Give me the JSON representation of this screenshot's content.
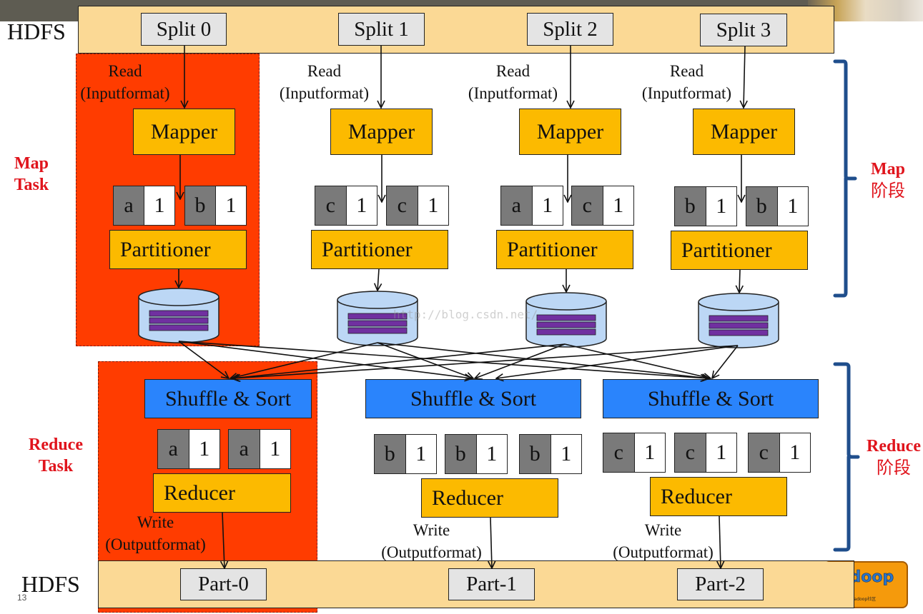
{
  "colors": {
    "hdfs_band": "#fbd995",
    "task_highlight": "#ff3c00",
    "split_box": "#e4e4e4",
    "mapper_box": "#fcba00",
    "shuffle_box": "#2a84fc",
    "key_cell": "#7a7a7a",
    "value_cell": "#ffffff",
    "disk": "#bcd7f5",
    "disk_bars": "#7030a0",
    "bracket": "#1f4e8c",
    "phase_label": "#e0141c"
  },
  "hdfs_top": {
    "label": "HDFS",
    "splits": [
      "Split 0",
      "Split 1",
      "Split 2",
      "Split 3"
    ]
  },
  "map_columns": [
    {
      "read_line1": "Read",
      "read_line2": "(Inputformat)",
      "mapper": "Mapper",
      "pairs": [
        {
          "k": "a",
          "v": "1"
        },
        {
          "k": "b",
          "v": "1"
        }
      ],
      "partitioner": "Partitioner"
    },
    {
      "read_line1": "Read",
      "read_line2": "(Inputformat)",
      "mapper": "Mapper",
      "pairs": [
        {
          "k": "c",
          "v": "1"
        },
        {
          "k": "c",
          "v": "1"
        }
      ],
      "partitioner": "Partitioner"
    },
    {
      "read_line1": "Read",
      "read_line2": "(Inputformat)",
      "mapper": "Mapper",
      "pairs": [
        {
          "k": "a",
          "v": "1"
        },
        {
          "k": "c",
          "v": "1"
        }
      ],
      "partitioner": "Partitioner"
    },
    {
      "read_line1": "Read",
      "read_line2": "(Inputformat)",
      "mapper": "Mapper",
      "pairs": [
        {
          "k": "b",
          "v": "1"
        },
        {
          "k": "b",
          "v": "1"
        }
      ],
      "partitioner": "Partitioner"
    }
  ],
  "reduce_columns": [
    {
      "shuffle": "Shuffle & Sort",
      "pairs": [
        {
          "k": "a",
          "v": "1"
        },
        {
          "k": "a",
          "v": "1"
        }
      ],
      "reducer": "Reducer",
      "write_line1": "Write",
      "write_line2": "(Outputformat)",
      "part": "Part-0"
    },
    {
      "shuffle": "Shuffle & Sort",
      "pairs": [
        {
          "k": "b",
          "v": "1"
        },
        {
          "k": "b",
          "v": "1"
        },
        {
          "k": "b",
          "v": "1"
        }
      ],
      "reducer": "Reducer",
      "write_line1": "Write",
      "write_line2": "(Outputformat)",
      "part": "Part-1"
    },
    {
      "shuffle": "Shuffle & Sort",
      "pairs": [
        {
          "k": "c",
          "v": "1"
        },
        {
          "k": "c",
          "v": "1"
        },
        {
          "k": "c",
          "v": "1"
        }
      ],
      "reducer": "Reducer",
      "write_line1": "Write",
      "write_line2": "(Outputformat)",
      "part": "Part-2"
    }
  ],
  "hdfs_bottom": {
    "label": "HDFS"
  },
  "left_labels": {
    "map_task_line1": "Map",
    "map_task_line2": "Task",
    "reduce_task_line1": "Reduce",
    "reduce_task_line2": "Task"
  },
  "right_labels": {
    "map_phase_line1": "Map",
    "map_phase_line2": "阶段",
    "reduce_phase_line1": "Reduce",
    "reduce_phase_line2": "阶段"
  },
  "page_number": "13",
  "watermark": "http://blog.csdn.net/",
  "logo": {
    "text": "hadoop",
    "subtext": "中国最大的Hadoop社区"
  }
}
